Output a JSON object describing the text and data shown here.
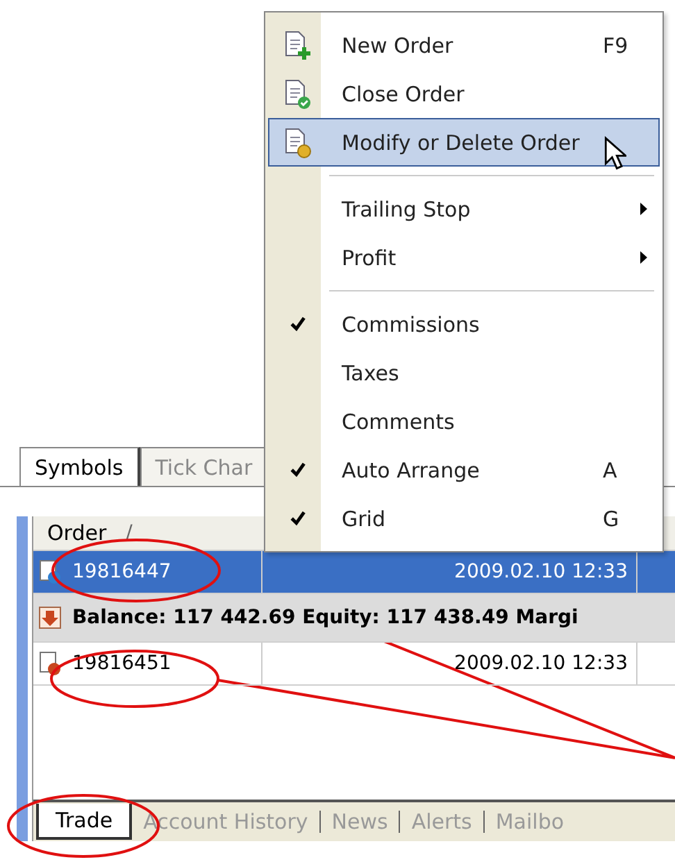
{
  "upper_tabs": [
    {
      "label": "Symbols",
      "selected": true
    },
    {
      "label": "Tick Char",
      "selected": false
    }
  ],
  "table": {
    "column_1": {
      "label": "Order",
      "sort_mark": "/"
    },
    "rows": [
      {
        "kind": "order",
        "selected": true,
        "color": "#2f7fd0",
        "cells": [
          "19816447",
          "2009.02.10 12:33"
        ]
      },
      {
        "kind": "balance",
        "text": "Balance: 117 442.69  Equity: 117 438.49  Margi"
      },
      {
        "kind": "order",
        "selected": false,
        "color": "#c8461e",
        "cells": [
          "19816451",
          "2009.02.10 12:33"
        ]
      }
    ]
  },
  "bottom_tabs": [
    {
      "label": "Trade",
      "selected": true
    },
    {
      "label": "Account History",
      "selected": false
    },
    {
      "label": "News",
      "selected": false
    },
    {
      "label": "Alerts",
      "selected": false
    },
    {
      "label": "Mailbo",
      "selected": false
    }
  ],
  "context_menu": {
    "items": [
      {
        "kind": "item",
        "label": "New Order",
        "shortcut": "F9",
        "checked": false,
        "submenu": false,
        "selected": false
      },
      {
        "kind": "item",
        "label": "Close Order",
        "checked": false,
        "submenu": false,
        "selected": false
      },
      {
        "kind": "item",
        "label": "Modify or Delete Order",
        "checked": false,
        "submenu": false,
        "selected": true
      },
      {
        "kind": "separator"
      },
      {
        "kind": "item",
        "label": "Trailing Stop",
        "checked": false,
        "submenu": true,
        "selected": false
      },
      {
        "kind": "item",
        "label": "Profit",
        "checked": false,
        "submenu": true,
        "selected": false
      },
      {
        "kind": "separator"
      },
      {
        "kind": "item",
        "label": "Commissions",
        "checked": true,
        "submenu": false,
        "selected": false
      },
      {
        "kind": "item",
        "label": "Taxes",
        "checked": false,
        "submenu": false,
        "selected": false
      },
      {
        "kind": "item",
        "label": "Comments",
        "checked": false,
        "submenu": false,
        "selected": false
      },
      {
        "kind": "item",
        "label": "Auto Arrange",
        "shortcut": "A",
        "checked": true,
        "submenu": false,
        "selected": false
      },
      {
        "kind": "item",
        "label": "Grid",
        "shortcut": "G",
        "checked": true,
        "submenu": false,
        "selected": false
      }
    ]
  }
}
